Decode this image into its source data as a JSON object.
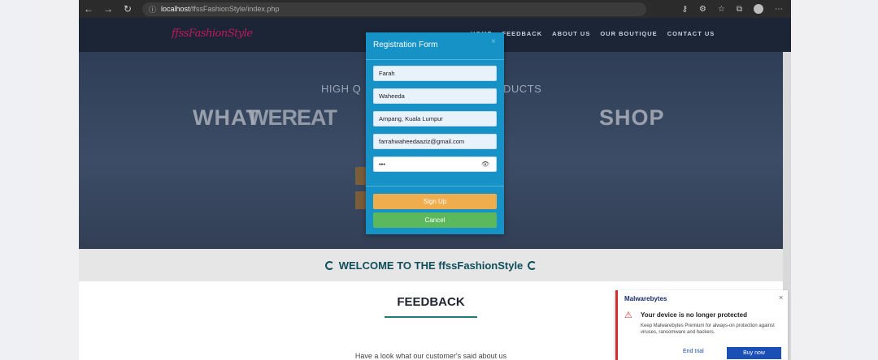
{
  "browser": {
    "url_host": "localhost",
    "url_path": "/ffssFashionStyle/index.php",
    "nav_icons": [
      "back-arrow",
      "forward-arrow",
      "refresh"
    ]
  },
  "site": {
    "logo": "ffssFashionStyle",
    "menu": [
      "HOME",
      "FEEDBACK",
      "ABOUT US",
      "OUR BOUTIQUE",
      "CONTACT US"
    ],
    "hero_sub_left": "HIGH Q",
    "hero_sub_right": "DUCTS",
    "hero_big_1": "WHAT",
    "hero_big_tail": "SHOP",
    "welcome": "WELCOME TO THE ffssFashionStyle",
    "feedback_heading": "FEEDBACK",
    "feedback_text": "Have a look what our customer's said about us"
  },
  "modal": {
    "title": "Registration Form",
    "close": "×",
    "fields": [
      {
        "name": "first-name",
        "value": "Farah"
      },
      {
        "name": "last-name",
        "value": "Waheeda"
      },
      {
        "name": "address",
        "value": "Ampang, Kuala Lumpur"
      },
      {
        "name": "email",
        "value": "farrahwaheedaaziz@gmail.com"
      },
      {
        "name": "password",
        "value": "•••"
      }
    ],
    "signup_label": "Sign Up",
    "cancel_label": "Cancel",
    "colors": {
      "header": "#1692c6",
      "signup": "#f0ad4e",
      "cancel": "#5cb85c"
    }
  },
  "toast": {
    "brand": "Malwarebytes",
    "close": "×",
    "heading": "Your device is no longer protected",
    "body": "Keep Malwarebytes Premium for always-on protection against viruses, ransomware and hackers.",
    "end_trial": "End trial",
    "buy_now": "Buy now"
  }
}
